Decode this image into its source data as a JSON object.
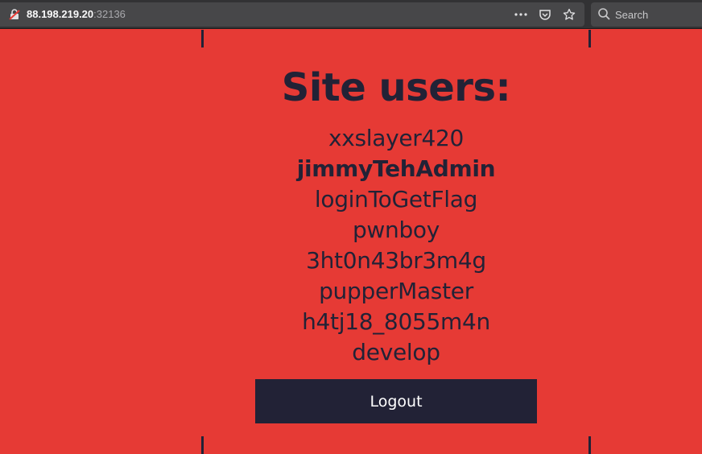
{
  "browser": {
    "url_host": "88.198.219.20",
    "url_port": ":32136",
    "search_placeholder": "Search"
  },
  "page": {
    "title": "Site users:",
    "users": [
      {
        "name": "xxslayer420",
        "bold": false
      },
      {
        "name": "jimmyTehAdmin",
        "bold": true
      },
      {
        "name": "loginToGetFlag",
        "bold": false
      },
      {
        "name": "pwnboy",
        "bold": false
      },
      {
        "name": "3ht0n43br3m4g",
        "bold": false
      },
      {
        "name": "pupperMaster",
        "bold": false
      },
      {
        "name": "h4tj18_8055m4n",
        "bold": false
      },
      {
        "name": "develop",
        "bold": false
      }
    ],
    "logout_label": "Logout",
    "background_color": "#e63a35",
    "text_color": "#222236"
  }
}
